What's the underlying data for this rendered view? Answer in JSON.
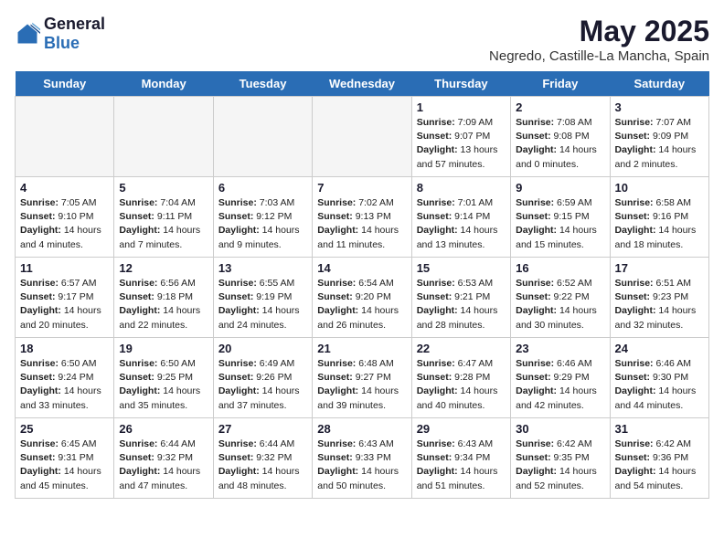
{
  "logo": {
    "general": "General",
    "blue": "Blue"
  },
  "title": "May 2025",
  "subtitle": "Negredo, Castille-La Mancha, Spain",
  "headers": [
    "Sunday",
    "Monday",
    "Tuesday",
    "Wednesday",
    "Thursday",
    "Friday",
    "Saturday"
  ],
  "weeks": [
    [
      {
        "day": "",
        "empty": true
      },
      {
        "day": "",
        "empty": true
      },
      {
        "day": "",
        "empty": true
      },
      {
        "day": "",
        "empty": true
      },
      {
        "day": "1",
        "sunrise": "7:09 AM",
        "sunset": "9:07 PM",
        "daylight": "13 hours and 57 minutes."
      },
      {
        "day": "2",
        "sunrise": "7:08 AM",
        "sunset": "9:08 PM",
        "daylight": "14 hours and 0 minutes."
      },
      {
        "day": "3",
        "sunrise": "7:07 AM",
        "sunset": "9:09 PM",
        "daylight": "14 hours and 2 minutes."
      }
    ],
    [
      {
        "day": "4",
        "sunrise": "7:05 AM",
        "sunset": "9:10 PM",
        "daylight": "14 hours and 4 minutes."
      },
      {
        "day": "5",
        "sunrise": "7:04 AM",
        "sunset": "9:11 PM",
        "daylight": "14 hours and 7 minutes."
      },
      {
        "day": "6",
        "sunrise": "7:03 AM",
        "sunset": "9:12 PM",
        "daylight": "14 hours and 9 minutes."
      },
      {
        "day": "7",
        "sunrise": "7:02 AM",
        "sunset": "9:13 PM",
        "daylight": "14 hours and 11 minutes."
      },
      {
        "day": "8",
        "sunrise": "7:01 AM",
        "sunset": "9:14 PM",
        "daylight": "14 hours and 13 minutes."
      },
      {
        "day": "9",
        "sunrise": "6:59 AM",
        "sunset": "9:15 PM",
        "daylight": "14 hours and 15 minutes."
      },
      {
        "day": "10",
        "sunrise": "6:58 AM",
        "sunset": "9:16 PM",
        "daylight": "14 hours and 18 minutes."
      }
    ],
    [
      {
        "day": "11",
        "sunrise": "6:57 AM",
        "sunset": "9:17 PM",
        "daylight": "14 hours and 20 minutes."
      },
      {
        "day": "12",
        "sunrise": "6:56 AM",
        "sunset": "9:18 PM",
        "daylight": "14 hours and 22 minutes."
      },
      {
        "day": "13",
        "sunrise": "6:55 AM",
        "sunset": "9:19 PM",
        "daylight": "14 hours and 24 minutes."
      },
      {
        "day": "14",
        "sunrise": "6:54 AM",
        "sunset": "9:20 PM",
        "daylight": "14 hours and 26 minutes."
      },
      {
        "day": "15",
        "sunrise": "6:53 AM",
        "sunset": "9:21 PM",
        "daylight": "14 hours and 28 minutes."
      },
      {
        "day": "16",
        "sunrise": "6:52 AM",
        "sunset": "9:22 PM",
        "daylight": "14 hours and 30 minutes."
      },
      {
        "day": "17",
        "sunrise": "6:51 AM",
        "sunset": "9:23 PM",
        "daylight": "14 hours and 32 minutes."
      }
    ],
    [
      {
        "day": "18",
        "sunrise": "6:50 AM",
        "sunset": "9:24 PM",
        "daylight": "14 hours and 33 minutes."
      },
      {
        "day": "19",
        "sunrise": "6:50 AM",
        "sunset": "9:25 PM",
        "daylight": "14 hours and 35 minutes."
      },
      {
        "day": "20",
        "sunrise": "6:49 AM",
        "sunset": "9:26 PM",
        "daylight": "14 hours and 37 minutes."
      },
      {
        "day": "21",
        "sunrise": "6:48 AM",
        "sunset": "9:27 PM",
        "daylight": "14 hours and 39 minutes."
      },
      {
        "day": "22",
        "sunrise": "6:47 AM",
        "sunset": "9:28 PM",
        "daylight": "14 hours and 40 minutes."
      },
      {
        "day": "23",
        "sunrise": "6:46 AM",
        "sunset": "9:29 PM",
        "daylight": "14 hours and 42 minutes."
      },
      {
        "day": "24",
        "sunrise": "6:46 AM",
        "sunset": "9:30 PM",
        "daylight": "14 hours and 44 minutes."
      }
    ],
    [
      {
        "day": "25",
        "sunrise": "6:45 AM",
        "sunset": "9:31 PM",
        "daylight": "14 hours and 45 minutes."
      },
      {
        "day": "26",
        "sunrise": "6:44 AM",
        "sunset": "9:32 PM",
        "daylight": "14 hours and 47 minutes."
      },
      {
        "day": "27",
        "sunrise": "6:44 AM",
        "sunset": "9:32 PM",
        "daylight": "14 hours and 48 minutes."
      },
      {
        "day": "28",
        "sunrise": "6:43 AM",
        "sunset": "9:33 PM",
        "daylight": "14 hours and 50 minutes."
      },
      {
        "day": "29",
        "sunrise": "6:43 AM",
        "sunset": "9:34 PM",
        "daylight": "14 hours and 51 minutes."
      },
      {
        "day": "30",
        "sunrise": "6:42 AM",
        "sunset": "9:35 PM",
        "daylight": "14 hours and 52 minutes."
      },
      {
        "day": "31",
        "sunrise": "6:42 AM",
        "sunset": "9:36 PM",
        "daylight": "14 hours and 54 minutes."
      }
    ]
  ],
  "sunrise_label": "Sunrise:",
  "sunset_label": "Sunset:",
  "daylight_label": "Daylight:"
}
